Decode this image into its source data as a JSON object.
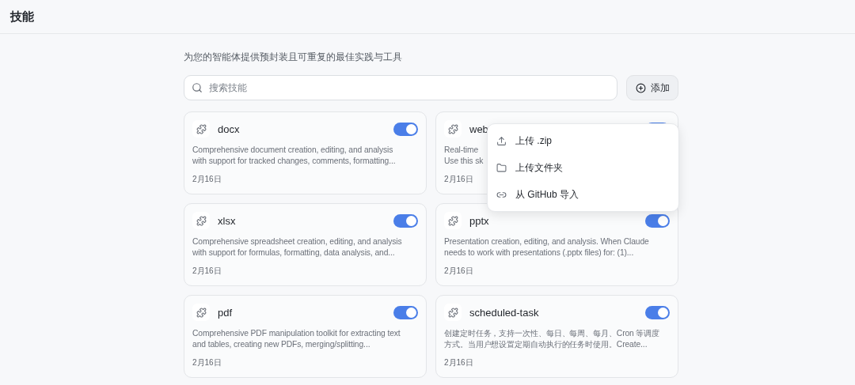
{
  "header": {
    "title": "技能"
  },
  "subtitle": "为您的智能体提供预封装且可重复的最佳实践与工具",
  "search": {
    "placeholder": "搜索技能"
  },
  "add_button": {
    "label": "添加"
  },
  "skills": [
    {
      "name": "docx",
      "on": true,
      "description_lines": [
        "Comprehensive document creation, editing, and analysis",
        "with support for tracked changes, comments, formatting..."
      ],
      "date": "2月16日"
    },
    {
      "name": "web",
      "on": true,
      "description_lines": [
        "Real-time",
        "Use this sk"
      ],
      "date": "2月16日"
    },
    {
      "name": "xlsx",
      "on": true,
      "description_lines": [
        "Comprehensive spreadsheet creation, editing, and analysis",
        "with support for formulas, formatting, data analysis, and..."
      ],
      "date": "2月16日"
    },
    {
      "name": "pptx",
      "on": true,
      "description_lines": [
        "Presentation creation, editing, and analysis. When Claude",
        "needs to work with presentations (.pptx files) for: (1)..."
      ],
      "date": "2月16日"
    },
    {
      "name": "pdf",
      "on": true,
      "description_lines": [
        "Comprehensive PDF manipulation toolkit for extracting text",
        "and tables, creating new PDFs, merging/splitting..."
      ],
      "date": "2月16日"
    },
    {
      "name": "scheduled-task",
      "on": true,
      "description_lines": [
        "创建定时任务，支持一次性、每日、每周、每月、Cron 等调度",
        "方式。当用户想设置定期自动执行的任务时使用。Create..."
      ],
      "date": "2月16日"
    }
  ],
  "add_menu": {
    "items": [
      {
        "kind": "upload",
        "label": "上传 .zip"
      },
      {
        "kind": "folder",
        "label": "上传文件夹"
      },
      {
        "kind": "link",
        "label": "从 GitHub 导入"
      }
    ]
  }
}
